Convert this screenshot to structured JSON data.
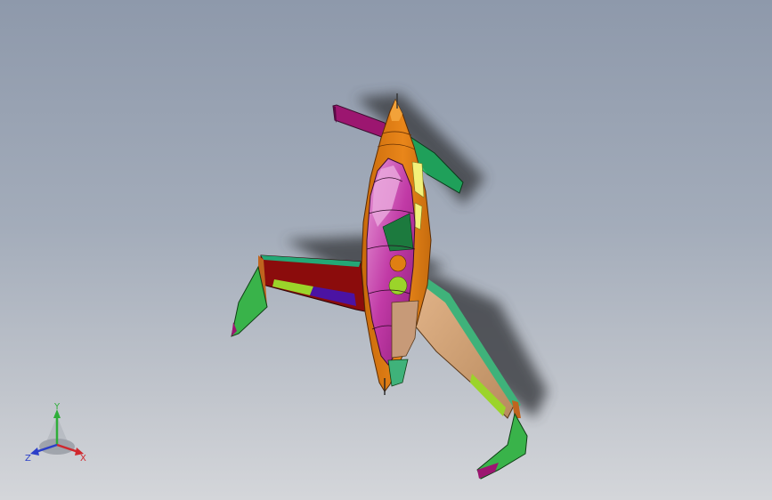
{
  "viewport": {
    "background_top": "#8e99ab",
    "background_bottom": "#d4d6da"
  },
  "model": {
    "colors": {
      "fuselage": "#e07f12",
      "canopy": "#b82d9a",
      "canopy_highlight": "#e28bd6",
      "wing_left_top": "#8b0c0c",
      "wing_left_edge": "#23a876",
      "winglet": "#39b34a",
      "canard": "#9c1670",
      "canard_right": "#1fa05a",
      "wing_right": "#c99a6e",
      "wing_right_edge": "#3fb27a",
      "accent_green": "#9bd42a",
      "accent_blue": "#4b13a3",
      "accent_yellow": "#f3f17a",
      "shadow": "#4a4d52"
    }
  },
  "triad": {
    "x_label": "X",
    "y_label": "Y",
    "z_label": "Z",
    "x_color": "#d0282e",
    "y_color": "#2fae3a",
    "z_color": "#2b3fc8"
  }
}
